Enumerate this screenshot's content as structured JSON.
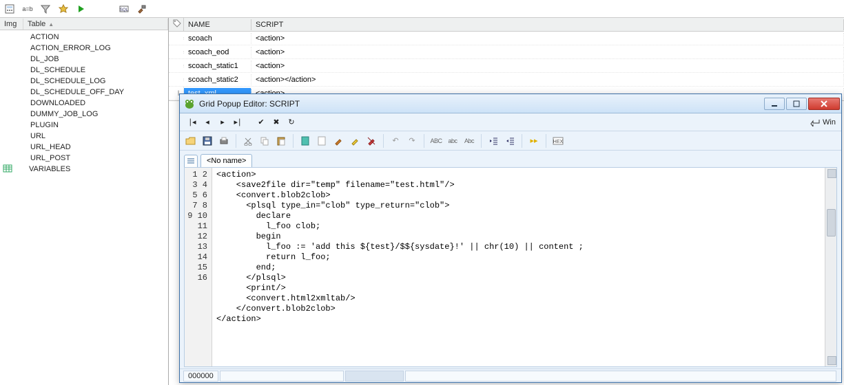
{
  "main_toolbar_icons": [
    "calc-icon",
    "ab-icon",
    "filter-icon",
    "star-icon",
    "run-icon",
    "sql-icon",
    "hammer-icon"
  ],
  "left": {
    "headers": {
      "img": "Img",
      "table": "Table"
    },
    "items": [
      {
        "name": "ACTION",
        "icon": ""
      },
      {
        "name": "ACTION_ERROR_LOG",
        "icon": ""
      },
      {
        "name": "DL_JOB",
        "icon": ""
      },
      {
        "name": "DL_SCHEDULE",
        "icon": ""
      },
      {
        "name": "DL_SCHEDULE_LOG",
        "icon": ""
      },
      {
        "name": "DL_SCHEDULE_OFF_DAY",
        "icon": ""
      },
      {
        "name": "DOWNLOADED",
        "icon": ""
      },
      {
        "name": "DUMMY_JOB_LOG",
        "icon": ""
      },
      {
        "name": "PLUGIN",
        "icon": ""
      },
      {
        "name": "URL",
        "icon": ""
      },
      {
        "name": "URL_HEAD",
        "icon": ""
      },
      {
        "name": "URL_POST",
        "icon": ""
      },
      {
        "name": "VARIABLES",
        "icon": "grid"
      }
    ]
  },
  "grid": {
    "headers": {
      "name": "NAME",
      "script": "SCRIPT"
    },
    "rows": [
      {
        "name": "scoach",
        "script": "<action>",
        "selected": false,
        "cursor": false
      },
      {
        "name": "scoach_eod",
        "script": "<action>",
        "selected": false,
        "cursor": false
      },
      {
        "name": "scoach_static1",
        "script": "<action>",
        "selected": false,
        "cursor": false
      },
      {
        "name": "scoach_static2",
        "script": "<action></action>",
        "selected": false,
        "cursor": false
      },
      {
        "name": "test_xml",
        "script": "<action>",
        "selected": true,
        "cursor": true
      }
    ]
  },
  "popup": {
    "title": "Grid Popup Editor: SCRIPT",
    "win_label": "Win",
    "tabname": "<No name>",
    "status_pos": "000000",
    "code_lines": [
      "<action>",
      "    <save2file dir=\"temp\" filename=\"test.html\"/>",
      "    <convert.blob2clob>",
      "      <plsql type_in=\"clob\" type_return=\"clob\">",
      "        declare",
      "          l_foo clob;",
      "        begin",
      "          l_foo := 'add this ${test}/$${sysdate}!' || chr(10) || content ;",
      "          return l_foo;",
      "        end;",
      "      </plsql>",
      "      <print/>",
      "      <convert.html2xmltab/>",
      "    </convert.blob2clob>",
      "</action>",
      ""
    ]
  }
}
